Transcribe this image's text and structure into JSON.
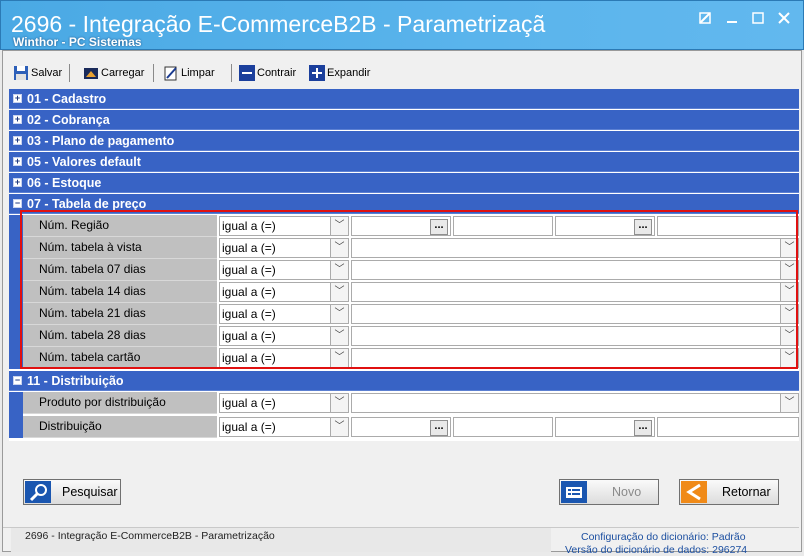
{
  "window": {
    "title": "2696 - Integração E-CommerceB2B - Parametrizaçã",
    "subtitle": "Winthor - PC Sistemas"
  },
  "toolbar": {
    "save": "Salvar",
    "load": "Carregar",
    "clear": "Limpar",
    "collapse": "Contrair",
    "expand": "Expandir"
  },
  "sections": [
    "01 - Cadastro",
    "02 - Cobrança",
    "03 - Plano de pagamento",
    "05 - Valores default",
    "06 - Estoque",
    "07 - Tabela de preço",
    "11 - Distribuição"
  ],
  "rows07": [
    {
      "label": "Núm. Região",
      "op": "igual a (=)"
    },
    {
      "label": "Núm. tabela à vista",
      "op": "igual a (=)"
    },
    {
      "label": "Núm. tabela 07 dias",
      "op": "igual a (=)"
    },
    {
      "label": "Núm. tabela 14 dias",
      "op": "igual a (=)"
    },
    {
      "label": "Núm. tabela 21 dias",
      "op": "igual a (=)"
    },
    {
      "label": "Núm. tabela 28 dias",
      "op": "igual a (=)"
    },
    {
      "label": "Núm. tabela cartão",
      "op": "igual a (=)"
    }
  ],
  "rows11": [
    {
      "label": "Produto por distribuição",
      "op": "igual a (=)"
    },
    {
      "label": "Distribuição",
      "op": "igual a (=)"
    }
  ],
  "buttons": {
    "search": "Pesquisar",
    "new": "Novo",
    "back": "Retornar"
  },
  "status": {
    "left": "2696 - Integração E-CommerceB2B - Parametrização",
    "config": "Configuração do dicionário: Padrão",
    "version": "Versão do dicionário de dados: 296274"
  },
  "colors": {
    "section": "#3863c5",
    "title": "#5ab4ec",
    "highlight": "#e01010"
  }
}
